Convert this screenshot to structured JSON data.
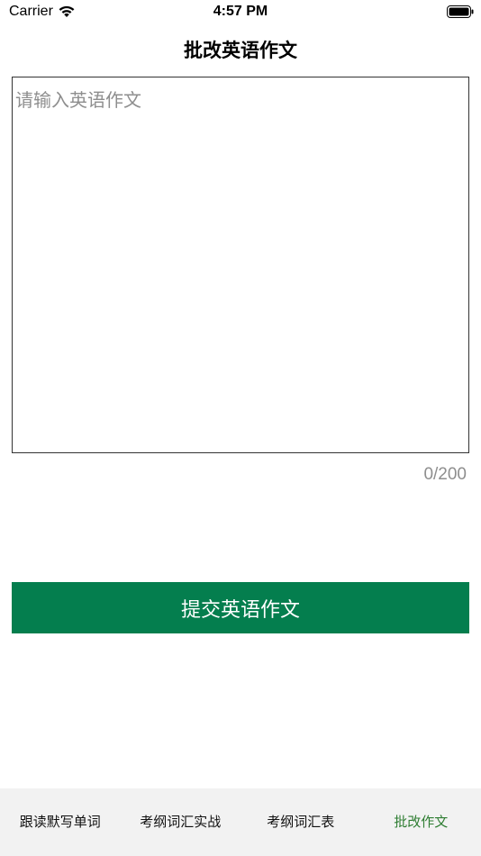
{
  "status_bar": {
    "carrier": "Carrier",
    "time": "4:57 PM"
  },
  "nav": {
    "title": "批改英语作文"
  },
  "essay": {
    "placeholder": "请输入英语作文",
    "value": "",
    "counter": "0/200"
  },
  "submit": {
    "label": "提交英语作文",
    "color": "#047e4e"
  },
  "tabs": [
    {
      "label": "跟读默写单词",
      "active": false
    },
    {
      "label": "考纲词汇实战",
      "active": false
    },
    {
      "label": "考纲词汇表",
      "active": false
    },
    {
      "label": "批改作文",
      "active": true
    }
  ],
  "colors": {
    "accent": "#047e4e",
    "active_tab": "#2e7d32",
    "tab_bar_bg": "#f2f2f2",
    "placeholder": "#8e8e8e"
  }
}
